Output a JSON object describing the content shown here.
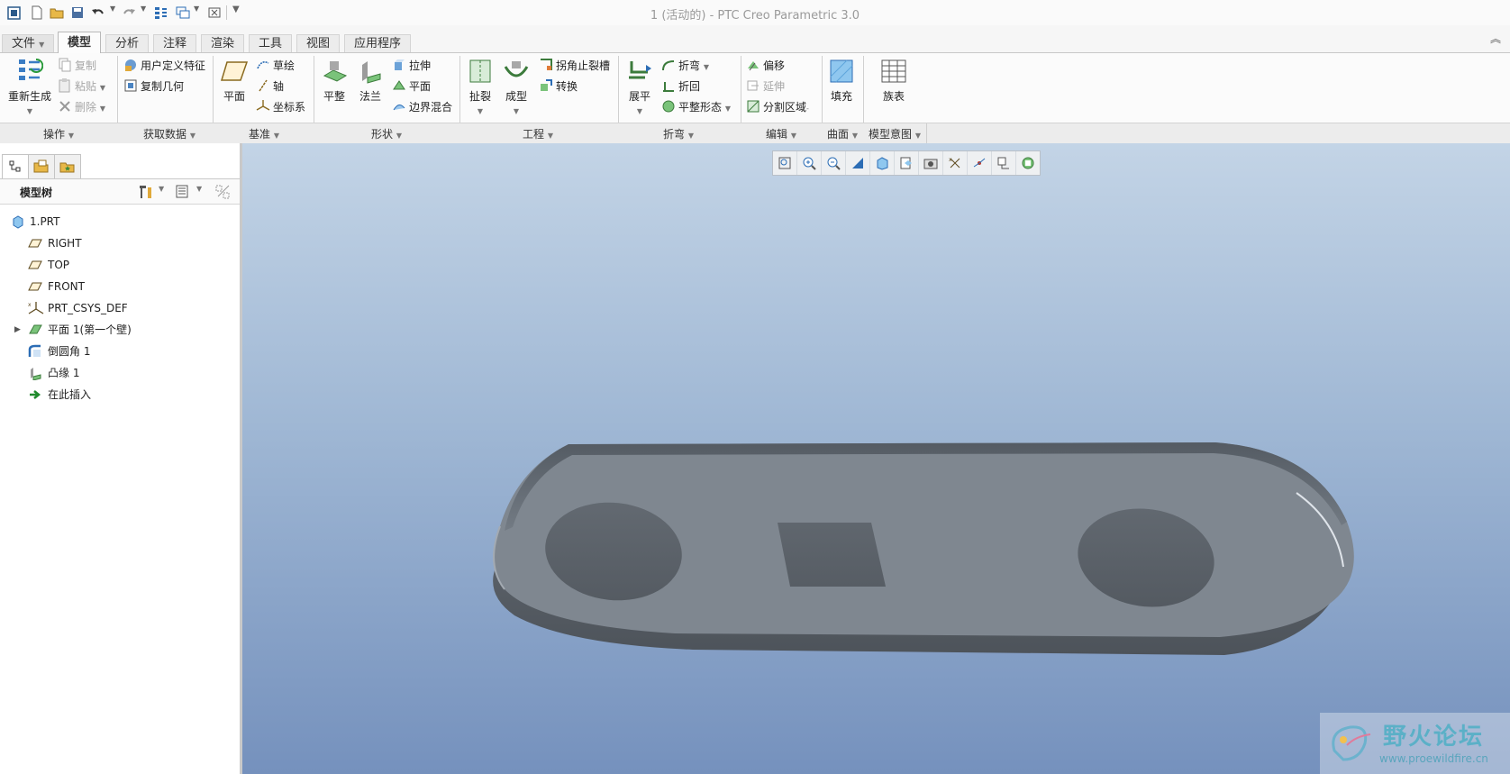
{
  "window": {
    "title": "1 (活动的) - PTC Creo Parametric 3.0"
  },
  "quick_access": [
    "window-icon",
    "new-file-icon",
    "open-folder-icon",
    "save-icon",
    "undo-icon",
    "redo-icon",
    "regenerate-icon",
    "window-switch-icon",
    "close-window-icon",
    "customize-icon"
  ],
  "tabs": [
    {
      "label": "文件",
      "id": "file"
    },
    {
      "label": "模型",
      "id": "model"
    },
    {
      "label": "分析",
      "id": "analysis"
    },
    {
      "label": "注释",
      "id": "annotate"
    },
    {
      "label": "渲染",
      "id": "render"
    },
    {
      "label": "工具",
      "id": "tools"
    },
    {
      "label": "视图",
      "id": "view"
    },
    {
      "label": "应用程序",
      "id": "apps"
    }
  ],
  "ribbon": {
    "operations": {
      "regenerate": "重新生成",
      "copy": "复制",
      "paste": "粘贴",
      "delete": "删除",
      "group": "操作"
    },
    "get_data": {
      "udf": "用户定义特征",
      "copy_geom": "复制几何",
      "group": "获取数据"
    },
    "datum": {
      "plane": "平面",
      "sketch": "草绘",
      "axis": "轴",
      "csys": "坐标系",
      "group": "基准"
    },
    "shapes": {
      "flat": "平整",
      "flange": "法兰",
      "extrude": "拉伸",
      "planar": "平面",
      "blend": "边界混合",
      "group": "形状"
    },
    "engineering": {
      "rip": "扯裂",
      "form": "成型",
      "corner_relief": "拐角止裂槽",
      "convert": "转换",
      "group": "工程"
    },
    "bends": {
      "unbend": "展平",
      "bend": "折弯",
      "bend_back": "折回",
      "flat_state": "平整形态",
      "group": "折弯"
    },
    "editing": {
      "offset": "偏移",
      "extend": "延伸",
      "split": "分割区域",
      "group": "编辑"
    },
    "surfaces": {
      "fill": "填充",
      "group": "曲面"
    },
    "model_intent": {
      "family": "族表",
      "group": "模型意图"
    }
  },
  "model_tree": {
    "header": "模型树",
    "items": [
      {
        "label": "1.PRT",
        "icon": "part-icon"
      },
      {
        "label": "RIGHT",
        "icon": "datum-plane-icon"
      },
      {
        "label": "TOP",
        "icon": "datum-plane-icon"
      },
      {
        "label": "FRONT",
        "icon": "datum-plane-icon"
      },
      {
        "label": "PRT_CSYS_DEF",
        "icon": "csys-icon"
      },
      {
        "label": "平面 1(第一个壁)",
        "icon": "planar-wall-icon"
      },
      {
        "label": "倒圆角 1",
        "icon": "round-icon"
      },
      {
        "label": "凸缘 1",
        "icon": "flange-icon"
      },
      {
        "label": "在此插入",
        "icon": "insert-here-icon"
      }
    ]
  },
  "view_toolbar": [
    "refit-icon",
    "zoom-in-icon",
    "zoom-out-icon",
    "repaint-icon",
    "display-style-icon",
    "saved-views-icon",
    "view-manager-icon",
    "datum-display-icon",
    "spin-center-icon",
    "annotation-display-icon",
    "appearance-icon"
  ],
  "watermark": {
    "text": "野火论坛",
    "url": "www.proewildfire.cn"
  },
  "colors": {
    "viewport_top": "#c3d4e6",
    "viewport_bottom": "#7591bd",
    "part": "#7f8790",
    "part_edge": "#5d646c"
  }
}
